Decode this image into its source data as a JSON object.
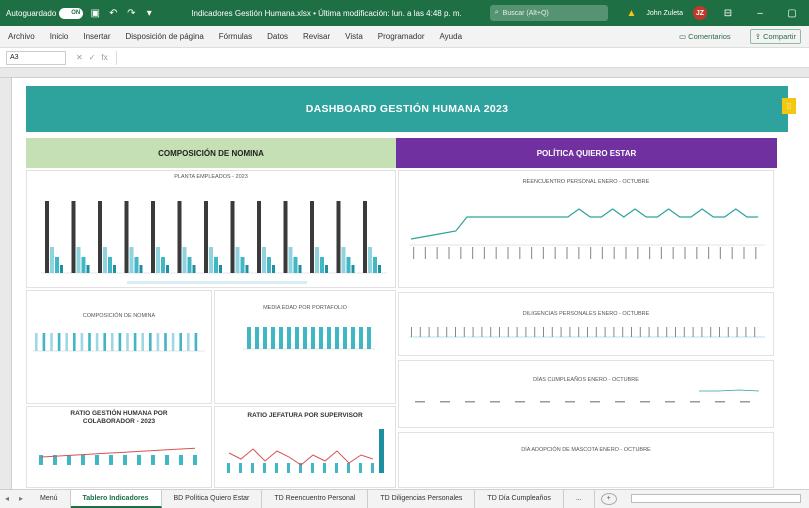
{
  "titlebar": {
    "autosave_label": "Autoguardado",
    "toggle_state": "ON",
    "doc_title": "Indicadores Gestión Humana.xlsx  •  Última modificación: lun. a las 4:48 p. m.",
    "search_placeholder": "Buscar (Alt+Q)",
    "user_name": "John Zuleta",
    "user_initials": "JZ"
  },
  "ribbon": {
    "menus": [
      "Archivo",
      "Inicio",
      "Insertar",
      "Disposición de página",
      "Fórmulas",
      "Datos",
      "Revisar",
      "Vista",
      "Programador",
      "Ayuda"
    ],
    "comments_label": "Comentarios",
    "share_label": "Compartir"
  },
  "formula_bar": {
    "cell_ref": "A3",
    "fx_label": "fx"
  },
  "dashboard": {
    "title": "DASHBOARD GESTIÓN HUMANA 2023",
    "section_left": "COMPOSICIÓN DE NOMINA",
    "section_right": "POLÍTICA QUIERO ESTAR",
    "charts": {
      "planta": "PLANTA EMPLEADOS - 2023",
      "composicion": "COMPOSICIÓN DE NOMINA",
      "media_edad": "MEDIA EDAD POR PORTAFOLIO",
      "ratio_gestion_1": "RATIO GESTIÓN HUMANA POR",
      "ratio_gestion_2": "COLABORADOR - 2023",
      "ratio_jefatura": "RATIO JEFATURA POR SUPERVISOR",
      "reencuentro": "REENCUENTRO PERSONAL ENERO - OCTUBRE",
      "diligencias": "DILIGENCIAS PERSONALES ENERO - OCTUBRE",
      "cumpleanos": "DÍAS CUMPLEAÑOS ENERO - OCTUBRE",
      "mascota": "DÍA ADOPCIÓN DE MASCOTA ENERO - OCTUBRE"
    },
    "accent_colors": {
      "header": "#2ea39d",
      "green_section": "#c5e0b4",
      "purple_section": "#7030a0",
      "bar_dark": "#3a3a3a",
      "bar_teal": "#41b6c4",
      "bar_light": "#8fd3df",
      "line_red": "#d9534f"
    }
  },
  "tabs": {
    "items": [
      "Menú",
      "Tablero Indicadores",
      "BD Política Quiero Estar",
      "TD Reencuentro Personal",
      "TD Diligencias Personales",
      "TD Día Cumpleaños"
    ],
    "active_index": 1,
    "more_label": "..."
  }
}
